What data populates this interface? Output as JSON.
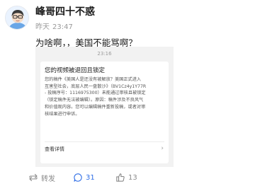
{
  "post": {
    "username": "峰哥四十不惑",
    "date": "昨天",
    "time": "23:47",
    "text": "为啥啊，，美国不能骂啊？"
  },
  "screenshot": {
    "time": "23:16",
    "card_title": "您的视频被退回且锁定",
    "body_lines": [
      "您的稿件《美国人是还没有被解放？美国正式进入",
      "互害型社会，底层人民一盘散沙》（BV1Cz4y1Y77R",
      "- 投稿序号：111697530​0）未能通过审核且被锁定",
      "（锁定稿件无法被编辑）。原因：稿件涉及不良风气",
      "和价值观内容。您可以编辑稿件重新投稿，或者对审",
      "核结果进行申诉。"
    ],
    "link_label": "查看详情",
    "chevron": "›"
  },
  "actions": {
    "repost_label": "转发",
    "comment_count": "31",
    "like_count": "13"
  },
  "icons": {
    "repost": "repost-icon",
    "comment": "comment-icon",
    "like": "like-icon",
    "chevron": "chevron-right-icon"
  },
  "colors": {
    "accent_blue": "#2f6ee6",
    "muted": "#8a8a8a",
    "screenshot_bg": "#f2f2f2"
  }
}
